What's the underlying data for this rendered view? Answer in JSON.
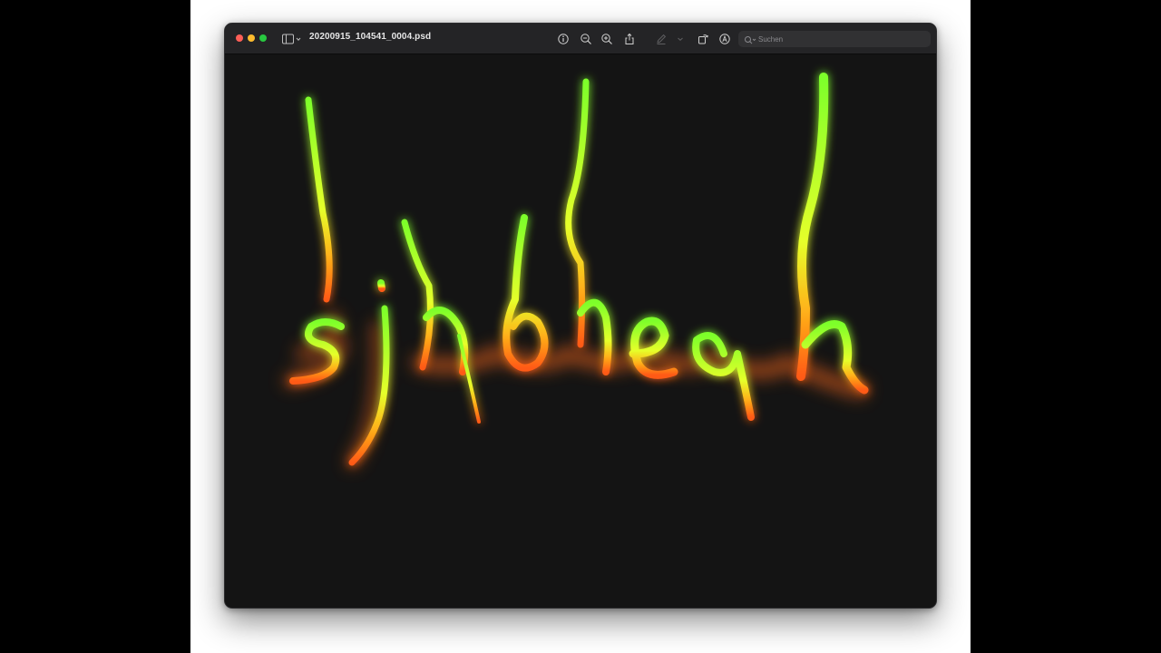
{
  "window": {
    "filename": "20200915_104541_0004.psd"
  },
  "toolbar": {
    "sidebar_icon": "sidebar-icon",
    "info_icon": "info-icon",
    "zoom_out_icon": "zoom-out-icon",
    "zoom_in_icon": "zoom-in-icon",
    "share_icon": "share-icon",
    "markup_icon": "markup-pen-icon",
    "rotate_icon": "rotate-icon",
    "annotate_icon": "annotate-icon"
  },
  "search": {
    "placeholder": "Suchen",
    "value": ""
  },
  "colors": {
    "window_bg": "#141414",
    "titlebar_bg": "#242426",
    "flame_green": "#7dff2a",
    "flame_yellow": "#eaff2a",
    "flame_orange": "#ff6a1a"
  }
}
